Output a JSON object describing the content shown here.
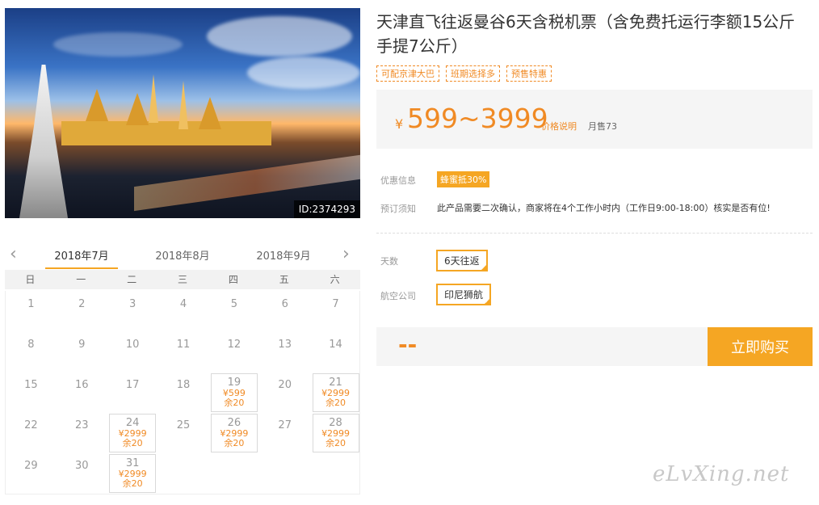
{
  "photo": {
    "id_label": "ID:2374293"
  },
  "calendar": {
    "months": [
      "2018年7月",
      "2018年8月",
      "2018年9月"
    ],
    "weekdays": [
      "日",
      "一",
      "二",
      "三",
      "四",
      "五",
      "六"
    ],
    "days": [
      {
        "d": "1"
      },
      {
        "d": "2"
      },
      {
        "d": "3"
      },
      {
        "d": "4"
      },
      {
        "d": "5"
      },
      {
        "d": "6"
      },
      {
        "d": "7"
      },
      {
        "d": "8"
      },
      {
        "d": "9"
      },
      {
        "d": "10"
      },
      {
        "d": "11"
      },
      {
        "d": "12"
      },
      {
        "d": "13"
      },
      {
        "d": "14"
      },
      {
        "d": "15"
      },
      {
        "d": "16"
      },
      {
        "d": "17"
      },
      {
        "d": "18"
      },
      {
        "d": "19",
        "price": "¥599",
        "stock": "余20"
      },
      {
        "d": "20"
      },
      {
        "d": "21",
        "price": "¥2999",
        "stock": "余20"
      },
      {
        "d": "22"
      },
      {
        "d": "23"
      },
      {
        "d": "24",
        "price": "¥2999",
        "stock": "余20"
      },
      {
        "d": "25"
      },
      {
        "d": "26",
        "price": "¥2999",
        "stock": "余20"
      },
      {
        "d": "27"
      },
      {
        "d": "28",
        "price": "¥2999",
        "stock": "余20"
      },
      {
        "d": "29"
      },
      {
        "d": "30"
      },
      {
        "d": "31",
        "price": "¥2999",
        "stock": "余20"
      }
    ]
  },
  "product": {
    "title": "天津直飞往返曼谷6天含税机票（含免费托运行李额15公斤手提7公斤）",
    "tags": [
      "可配京津大巴",
      "班期选择多",
      "预售特惠"
    ],
    "price_currency": "¥",
    "price_range": "599~3999",
    "price_note": "价格说明",
    "monthly_sales": "月售73"
  },
  "info": {
    "discount_label": "优惠信息",
    "discount_badge": "蜂蜜抵30%",
    "notice_label": "预订须知",
    "notice_text": "此产品需要二次确认，商家将在4个工作小时内（工作日9:00-18:00）核实是否有位!"
  },
  "options": {
    "days_label": "天数",
    "days_value": "6天往返",
    "airline_label": "航空公司",
    "airline_value": "印尼狮航"
  },
  "purchase": {
    "total": "--",
    "buy_label": "立即购买"
  },
  "watermark": "eLvXing.net",
  "colors": {
    "accent": "#f5a623",
    "price": "#f08a24"
  }
}
